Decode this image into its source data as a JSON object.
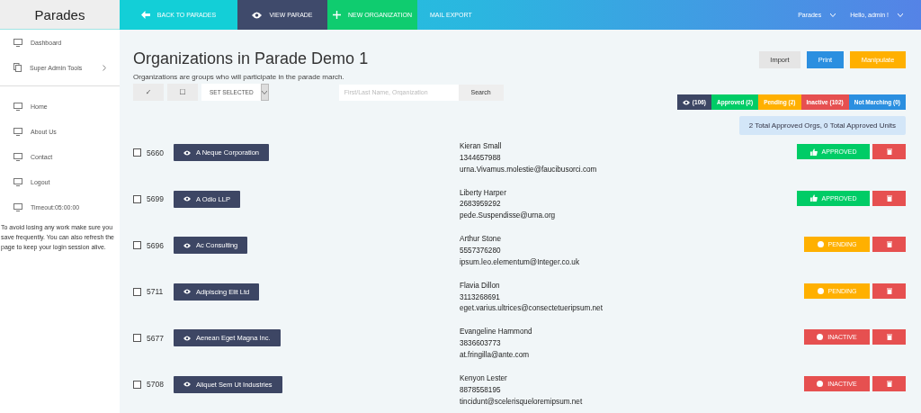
{
  "brand": "Parades",
  "topnav": [
    {
      "label": "BACK TO PARADES",
      "kind": "back",
      "selected": false
    },
    {
      "label": "VIEW PARADE",
      "kind": "view",
      "selected": true
    },
    {
      "label": "NEW ORGANIZATION",
      "kind": "new",
      "selected": false
    },
    {
      "label": "MAIL EXPORT",
      "kind": "plain",
      "selected": false
    }
  ],
  "user_menu": [
    {
      "label": "Parades"
    },
    {
      "label": "Hello, admin !"
    }
  ],
  "sidebar": {
    "items": [
      {
        "label": "Dashboard",
        "kind": "link"
      },
      {
        "label": "Super Admin Tools",
        "kind": "submenu"
      }
    ],
    "lower_items": [
      {
        "label": "Home",
        "kind": "link"
      },
      {
        "label": "About Us",
        "kind": "link"
      },
      {
        "label": "Contact",
        "kind": "link"
      },
      {
        "label": "Logout",
        "kind": "link"
      },
      {
        "label": "Timeout:05:00:00",
        "kind": "link"
      }
    ],
    "note": "To avoid losing any work make sure you save frequently. You can also refresh the page to keep your login session alive."
  },
  "page": {
    "title": "Organizations in Parade Demo 1",
    "subtitle": "Organizations are groups who will participate in the parade march.",
    "actions": [
      {
        "label": "Import",
        "kind": "plain"
      },
      {
        "label": "Print",
        "kind": "primary"
      },
      {
        "label": "Manipulate",
        "kind": "warning"
      }
    ],
    "bulk": {
      "check_all": "✓",
      "uncheck_all": "☐",
      "set_selected": "SET SELECTED"
    },
    "search": {
      "placeholder": "First/Last Name, Organization",
      "button": "Search"
    },
    "filters": [
      {
        "label": "(106)",
        "kind": "all"
      },
      {
        "label": "Approved (2)",
        "kind": "approved"
      },
      {
        "label": "Pending (2)",
        "kind": "pending"
      },
      {
        "label": "Inactive (102)",
        "kind": "inactive"
      },
      {
        "label": "Not Marching (0)",
        "kind": "not_marching"
      }
    ],
    "summary": "2 Total Approved Orgs, 0 Total Approved Units"
  },
  "rows": [
    {
      "id": "5660",
      "checked": false,
      "name": "A Neque Corporation",
      "contact": "Kieran Small",
      "phone": "1344657988",
      "email": "urna.Vivamus.molestie@faucibusorci.com",
      "status": "APPROVED",
      "kind": "approved"
    },
    {
      "id": "5699",
      "checked": false,
      "name": "A Odio LLP",
      "contact": "Liberty Harper",
      "phone": "2683959292",
      "email": "pede.Suspendisse@urna.org",
      "status": "APPROVED",
      "kind": "approved"
    },
    {
      "id": "5696",
      "checked": false,
      "name": "Ac Consulting",
      "contact": "Arthur Stone",
      "phone": "5557376280",
      "email": "ipsum.leo.elementum@Integer.co.uk",
      "status": "PENDING",
      "kind": "pending"
    },
    {
      "id": "5711",
      "checked": false,
      "name": "Adipiscing Elit Ltd",
      "contact": "Flavia Dillon",
      "phone": "3113268691",
      "email": "eget.varius.ultrices@consectetueripsum.net",
      "status": "PENDING",
      "kind": "pending"
    },
    {
      "id": "5677",
      "checked": false,
      "name": "Aenean Eget Magna Inc.",
      "contact": "Evangeline Hammond",
      "phone": "3836603773",
      "email": "at.fringilla@ante.com",
      "status": "INACTIVE",
      "kind": "inactive"
    },
    {
      "id": "5708",
      "checked": false,
      "name": "Aliquet Sem Ut Industries",
      "contact": "Kenyon Lester",
      "phone": "8878558195",
      "email": "tincidunt@scelerisqueloremipsum.net",
      "status": "INACTIVE",
      "kind": "inactive"
    }
  ]
}
